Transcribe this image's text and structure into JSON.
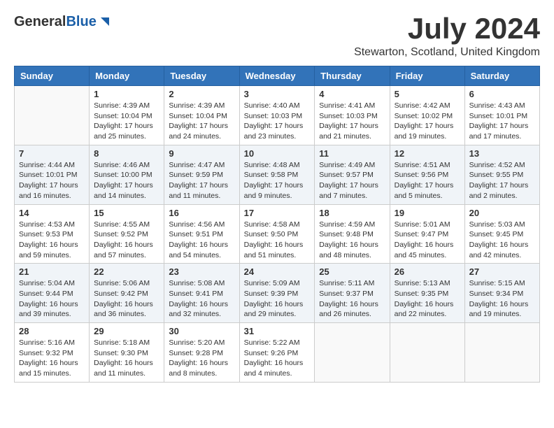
{
  "header": {
    "logo_general": "General",
    "logo_blue": "Blue",
    "month_title": "July 2024",
    "location": "Stewarton, Scotland, United Kingdom"
  },
  "weekdays": [
    "Sunday",
    "Monday",
    "Tuesday",
    "Wednesday",
    "Thursday",
    "Friday",
    "Saturday"
  ],
  "weeks": [
    [
      {
        "day": "",
        "info": ""
      },
      {
        "day": "1",
        "info": "Sunrise: 4:39 AM\nSunset: 10:04 PM\nDaylight: 17 hours\nand 25 minutes."
      },
      {
        "day": "2",
        "info": "Sunrise: 4:39 AM\nSunset: 10:04 PM\nDaylight: 17 hours\nand 24 minutes."
      },
      {
        "day": "3",
        "info": "Sunrise: 4:40 AM\nSunset: 10:03 PM\nDaylight: 17 hours\nand 23 minutes."
      },
      {
        "day": "4",
        "info": "Sunrise: 4:41 AM\nSunset: 10:03 PM\nDaylight: 17 hours\nand 21 minutes."
      },
      {
        "day": "5",
        "info": "Sunrise: 4:42 AM\nSunset: 10:02 PM\nDaylight: 17 hours\nand 19 minutes."
      },
      {
        "day": "6",
        "info": "Sunrise: 4:43 AM\nSunset: 10:01 PM\nDaylight: 17 hours\nand 17 minutes."
      }
    ],
    [
      {
        "day": "7",
        "info": "Sunrise: 4:44 AM\nSunset: 10:01 PM\nDaylight: 17 hours\nand 16 minutes."
      },
      {
        "day": "8",
        "info": "Sunrise: 4:46 AM\nSunset: 10:00 PM\nDaylight: 17 hours\nand 14 minutes."
      },
      {
        "day": "9",
        "info": "Sunrise: 4:47 AM\nSunset: 9:59 PM\nDaylight: 17 hours\nand 11 minutes."
      },
      {
        "day": "10",
        "info": "Sunrise: 4:48 AM\nSunset: 9:58 PM\nDaylight: 17 hours\nand 9 minutes."
      },
      {
        "day": "11",
        "info": "Sunrise: 4:49 AM\nSunset: 9:57 PM\nDaylight: 17 hours\nand 7 minutes."
      },
      {
        "day": "12",
        "info": "Sunrise: 4:51 AM\nSunset: 9:56 PM\nDaylight: 17 hours\nand 5 minutes."
      },
      {
        "day": "13",
        "info": "Sunrise: 4:52 AM\nSunset: 9:55 PM\nDaylight: 17 hours\nand 2 minutes."
      }
    ],
    [
      {
        "day": "14",
        "info": "Sunrise: 4:53 AM\nSunset: 9:53 PM\nDaylight: 16 hours\nand 59 minutes."
      },
      {
        "day": "15",
        "info": "Sunrise: 4:55 AM\nSunset: 9:52 PM\nDaylight: 16 hours\nand 57 minutes."
      },
      {
        "day": "16",
        "info": "Sunrise: 4:56 AM\nSunset: 9:51 PM\nDaylight: 16 hours\nand 54 minutes."
      },
      {
        "day": "17",
        "info": "Sunrise: 4:58 AM\nSunset: 9:50 PM\nDaylight: 16 hours\nand 51 minutes."
      },
      {
        "day": "18",
        "info": "Sunrise: 4:59 AM\nSunset: 9:48 PM\nDaylight: 16 hours\nand 48 minutes."
      },
      {
        "day": "19",
        "info": "Sunrise: 5:01 AM\nSunset: 9:47 PM\nDaylight: 16 hours\nand 45 minutes."
      },
      {
        "day": "20",
        "info": "Sunrise: 5:03 AM\nSunset: 9:45 PM\nDaylight: 16 hours\nand 42 minutes."
      }
    ],
    [
      {
        "day": "21",
        "info": "Sunrise: 5:04 AM\nSunset: 9:44 PM\nDaylight: 16 hours\nand 39 minutes."
      },
      {
        "day": "22",
        "info": "Sunrise: 5:06 AM\nSunset: 9:42 PM\nDaylight: 16 hours\nand 36 minutes."
      },
      {
        "day": "23",
        "info": "Sunrise: 5:08 AM\nSunset: 9:41 PM\nDaylight: 16 hours\nand 32 minutes."
      },
      {
        "day": "24",
        "info": "Sunrise: 5:09 AM\nSunset: 9:39 PM\nDaylight: 16 hours\nand 29 minutes."
      },
      {
        "day": "25",
        "info": "Sunrise: 5:11 AM\nSunset: 9:37 PM\nDaylight: 16 hours\nand 26 minutes."
      },
      {
        "day": "26",
        "info": "Sunrise: 5:13 AM\nSunset: 9:35 PM\nDaylight: 16 hours\nand 22 minutes."
      },
      {
        "day": "27",
        "info": "Sunrise: 5:15 AM\nSunset: 9:34 PM\nDaylight: 16 hours\nand 19 minutes."
      }
    ],
    [
      {
        "day": "28",
        "info": "Sunrise: 5:16 AM\nSunset: 9:32 PM\nDaylight: 16 hours\nand 15 minutes."
      },
      {
        "day": "29",
        "info": "Sunrise: 5:18 AM\nSunset: 9:30 PM\nDaylight: 16 hours\nand 11 minutes."
      },
      {
        "day": "30",
        "info": "Sunrise: 5:20 AM\nSunset: 9:28 PM\nDaylight: 16 hours\nand 8 minutes."
      },
      {
        "day": "31",
        "info": "Sunrise: 5:22 AM\nSunset: 9:26 PM\nDaylight: 16 hours\nand 4 minutes."
      },
      {
        "day": "",
        "info": ""
      },
      {
        "day": "",
        "info": ""
      },
      {
        "day": "",
        "info": ""
      }
    ]
  ]
}
